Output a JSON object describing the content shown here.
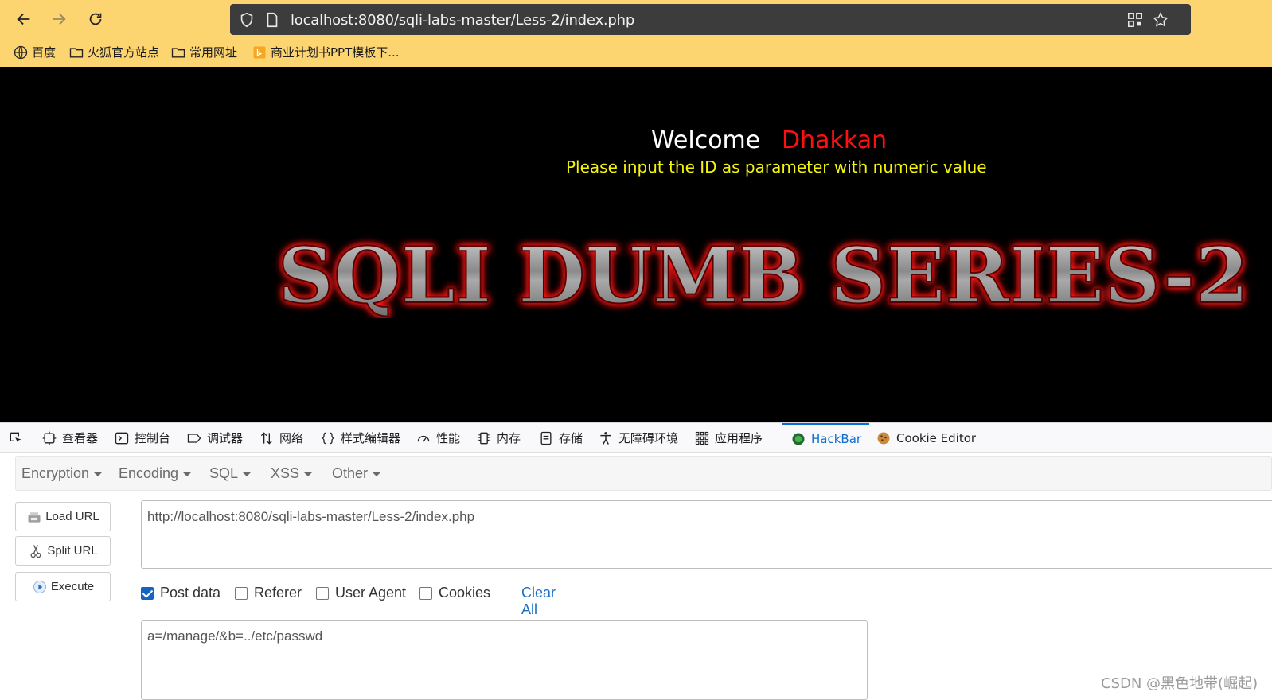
{
  "browser": {
    "url": "localhost:8080/sqli-labs-master/Less-2/index.php",
    "bookmarks": [
      "百度",
      "火狐官方站点",
      "常用网址",
      "商业计划书PPT模板下..."
    ]
  },
  "page": {
    "welcome": "Welcome",
    "name": "Dhakkan",
    "instruction": "Please input the ID as parameter with numeric value",
    "banner": "SQLI DUMB SERIES-2"
  },
  "devtools": {
    "tabs": [
      "查看器",
      "控制台",
      "调试器",
      "网络",
      "样式编辑器",
      "性能",
      "内存",
      "存储",
      "无障碍环境",
      "应用程序",
      "HackBar",
      "Cookie Editor"
    ],
    "active_tab": "HackBar"
  },
  "hackbar": {
    "menus": [
      "Encryption",
      "Encoding",
      "SQL",
      "XSS",
      "Other"
    ],
    "buttons": {
      "load": "Load URL",
      "split": "Split URL",
      "execute": "Execute"
    },
    "url_value": "http://localhost:8080/sqli-labs-master/Less-2/index.php",
    "options": [
      {
        "label": "Post data",
        "checked": true
      },
      {
        "label": "Referer",
        "checked": false
      },
      {
        "label": "User Agent",
        "checked": false
      },
      {
        "label": "Cookies",
        "checked": false
      }
    ],
    "clear_all": "Clear All",
    "post_value": "a=/manage/&b=../etc/passwd"
  },
  "watermark": "CSDN @黑色地带(崛起)",
  "colors": {
    "chrome": "#fcd571",
    "accent": "#0b6dd1",
    "banner_glow": "#ff1a1a"
  }
}
